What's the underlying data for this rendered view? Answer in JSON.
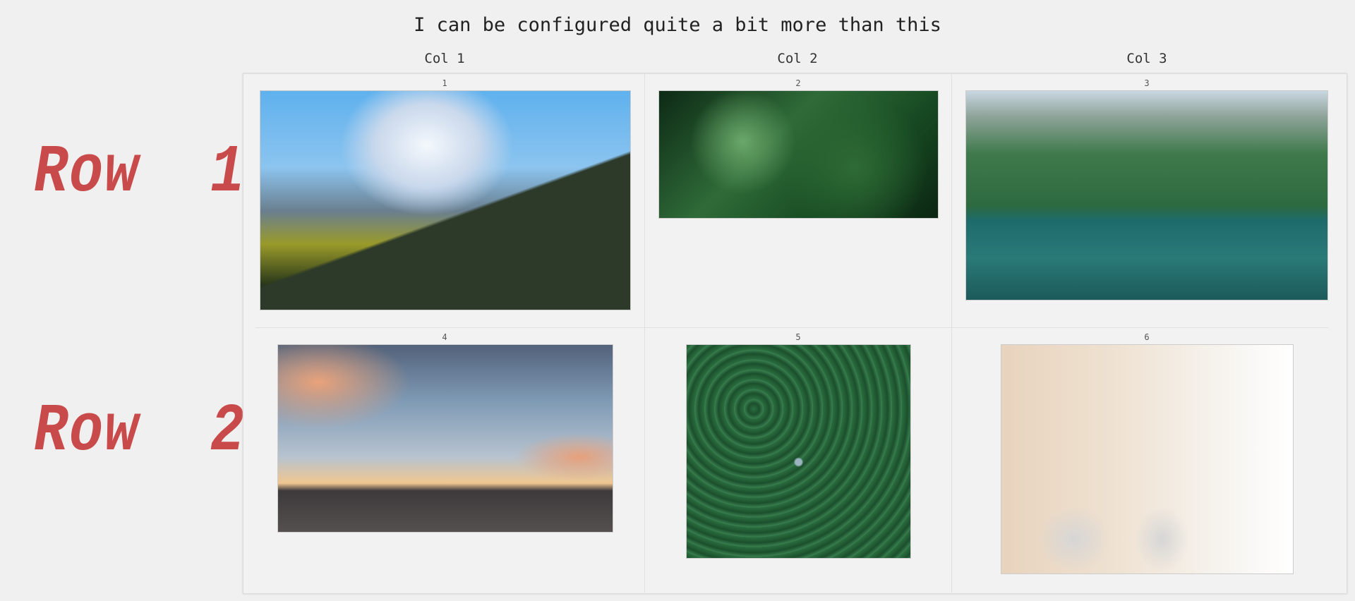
{
  "title": "I can be configured quite a bit more than this",
  "columns": [
    "Col 1",
    "Col 2",
    "Col 3"
  ],
  "rows": [
    "Row  1",
    "Row  2"
  ],
  "cells": [
    {
      "number": "1",
      "image": "mountain-road-photo"
    },
    {
      "number": "2",
      "image": "jungle-leaves-photo"
    },
    {
      "number": "3",
      "image": "mountain-lake-photo"
    },
    {
      "number": "4",
      "image": "sunset-sea-photo"
    },
    {
      "number": "5",
      "image": "plane-in-forest-photo"
    },
    {
      "number": "6",
      "image": "office-interior-photo"
    }
  ],
  "colors": {
    "row_label": "#c94a4a",
    "background": "#f0f0f0"
  }
}
